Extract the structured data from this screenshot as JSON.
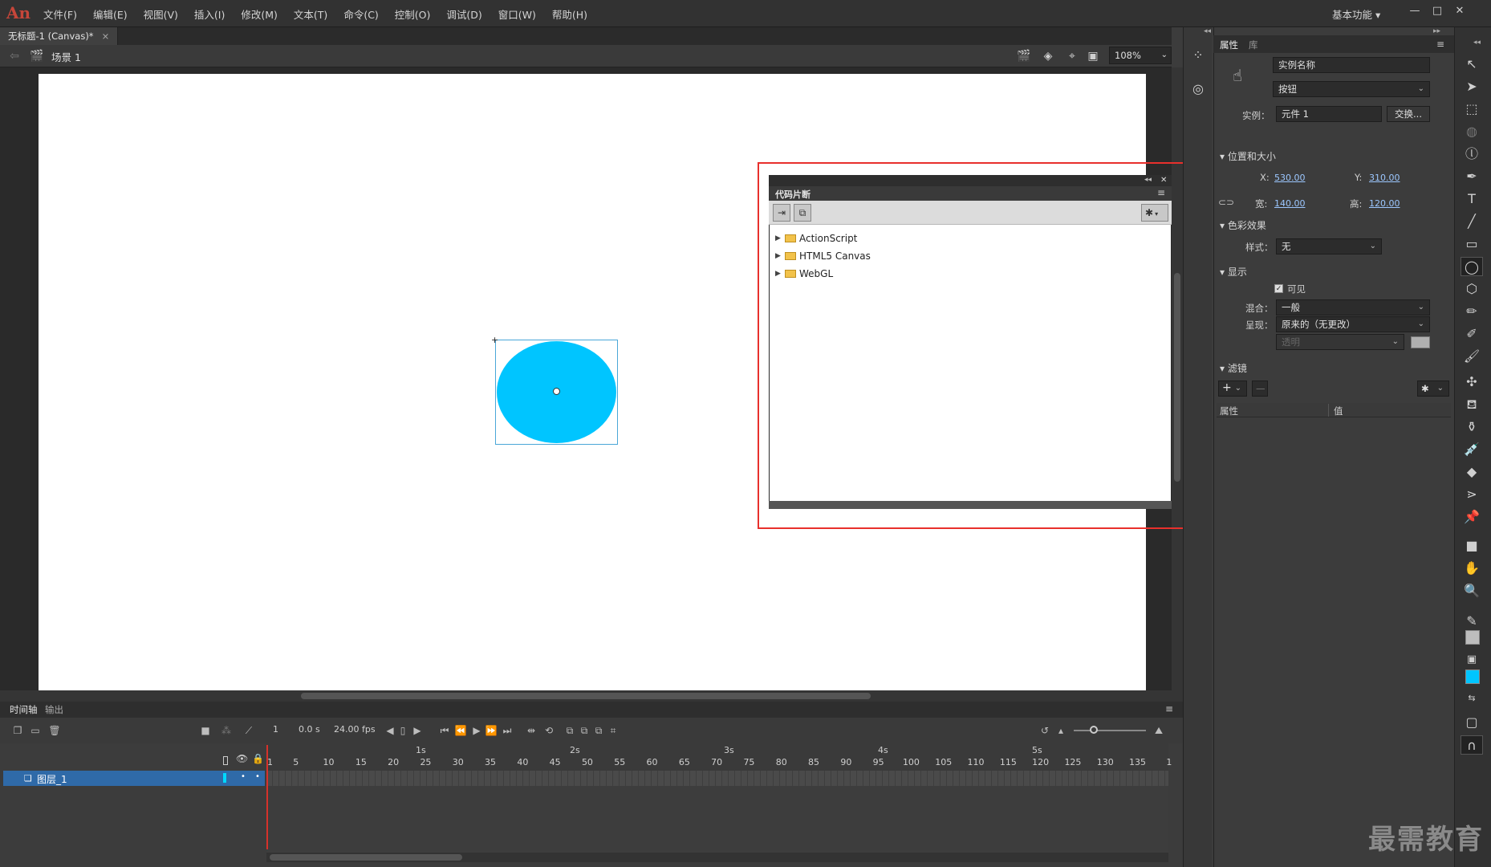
{
  "app": {
    "logo": "An",
    "menus": [
      "文件(F)",
      "编辑(E)",
      "视图(V)",
      "插入(I)",
      "修改(M)",
      "文本(T)",
      "命令(C)",
      "控制(O)",
      "调试(D)",
      "窗口(W)",
      "帮助(H)"
    ],
    "workspace": "基本功能",
    "workspace_arrow": "▾",
    "window_buttons": [
      "—",
      "□",
      "✕"
    ]
  },
  "document": {
    "tab_title": "无标题-1 (Canvas)*",
    "tab_close": "×",
    "scene_label": "场景 1",
    "zoom": "108%",
    "zoom_arrow": "⌄"
  },
  "code_snippets": {
    "title": "代码片断",
    "folders": [
      "ActionScript",
      "HTML5 Canvas",
      "WebGL"
    ],
    "gear": "✱",
    "gear_arrow": "▾",
    "expand_arrow": "▶",
    "menu_glyph": "≡",
    "collapse_glyph": "◂◂",
    "close_glyph": "✕"
  },
  "timeline": {
    "tab_timeline": "时间轴",
    "tab_output": "输出",
    "current_frame": "1",
    "time": "0.0 s",
    "fps": "24.00 fps",
    "layer_name": "图层_1",
    "frame_ticks": [
      "1",
      "5",
      "10",
      "15",
      "20",
      "25",
      "30",
      "35",
      "40",
      "45",
      "50",
      "55",
      "60",
      "65",
      "70",
      "75",
      "80",
      "85",
      "90",
      "95",
      "100",
      "105",
      "110",
      "115",
      "120",
      "125",
      "130",
      "135",
      "1"
    ],
    "seconds": [
      "1s",
      "2s",
      "3s",
      "4s",
      "5s"
    ]
  },
  "properties": {
    "tab_properties": "属性",
    "tab_library": "库",
    "instance_name_placeholder": "实例名称",
    "symbol_type": "按钮",
    "instance_label": "实例：",
    "instance_value": "元件 1",
    "swap_button": "交换...",
    "section_position": "位置和大小",
    "x_label": "X:",
    "x_value": "530.00",
    "y_label": "Y:",
    "y_value": "310.00",
    "w_label": "宽:",
    "w_value": "140.00",
    "h_label": "高:",
    "h_value": "120.00",
    "section_color": "色彩效果",
    "style_label": "样式：",
    "style_value": "无",
    "section_display": "显示",
    "visible_label": "可见",
    "blend_label": "混合：",
    "blend_value": "一般",
    "render_label": "呈现：",
    "render_value": "原来的（无更改）",
    "transparent_value": "透明",
    "section_filters": "滤镜",
    "col_property": "属性",
    "col_value": "值",
    "plus": "+",
    "minus": "—",
    "gear": "✱"
  },
  "colors": {
    "ellipse_fill": "#00c5ff",
    "highlight": "#e8302c",
    "fill_swatch": "#00c5ff"
  },
  "watermark": "最需教育"
}
